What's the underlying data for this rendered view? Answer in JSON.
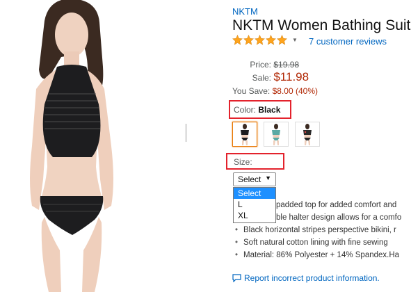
{
  "product": {
    "brand": "NKTM",
    "title": "NKTM Women Bathing Suit T",
    "reviews_link": "7 customer reviews",
    "rating_stars": 5
  },
  "pricing": {
    "price_label": "Price:",
    "list_price": "$19.98",
    "sale_label": "Sale:",
    "sale_price": "$11.98",
    "save_label": "You Save:",
    "save_value": "$8.00 (40%)"
  },
  "color": {
    "label": "Color:",
    "value": "Black",
    "swatches": [
      "black-bikini",
      "teal-bikini",
      "floral-bikini"
    ],
    "highlight": "#e3222c"
  },
  "size": {
    "label": "Size:",
    "selected": "Select",
    "options": [
      "Select",
      "L",
      "XL"
    ]
  },
  "bullets": [
    "padded top for added comfort and",
    "ble halter design allows for a comfo",
    "Black horizontal stripes perspective bikini, r",
    "Soft natural cotton lining with fine sewing",
    "Material: 86% Polyester + 14% Spandex.Ha"
  ],
  "report_link": "Report incorrect product information."
}
